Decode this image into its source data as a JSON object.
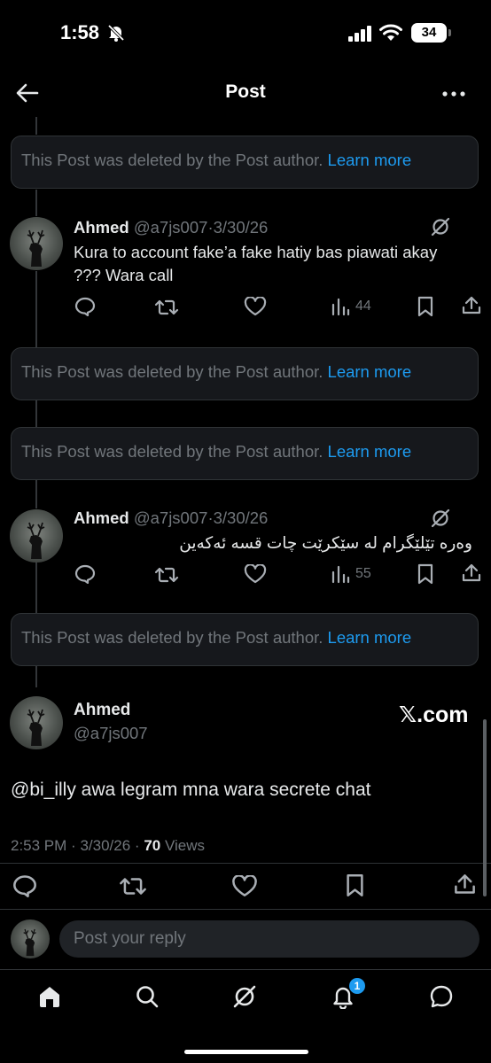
{
  "status_bar": {
    "time": "1:58",
    "battery": "34"
  },
  "header": {
    "title": "Post"
  },
  "deleted_notice": {
    "text": "This Post was deleted by the Post author.",
    "link": "Learn more"
  },
  "replies": [
    {
      "name": "Ahmed",
      "handle": "@a7js007",
      "separator": "·",
      "date": "3/30/26",
      "text": "Kura to account fake’a fake hatiy bas piawati akay ??? Wara call",
      "views": "44"
    },
    {
      "name": "Ahmed",
      "handle": "@a7js007",
      "separator": "·",
      "date": "3/30/26",
      "text": "وەرە تێلێگرام لە سێکرێت چات قسە ئەکەین",
      "views": "55"
    }
  ],
  "main_post": {
    "name": "Ahmed",
    "handle": "@a7js007",
    "source": "𝕏.com",
    "text": "@bi_illy awa legram mna wara secrete chat",
    "time": "2:53 PM",
    "date": "3/30/26",
    "separator": "·",
    "views_count": "70",
    "views_label": "Views"
  },
  "reply_box": {
    "placeholder": "Post your reply"
  },
  "bottom_nav": {
    "notification_count": "1"
  },
  "colors": {
    "background": "#000000",
    "accent": "#1d9bf0",
    "card": "#16181c",
    "muted": "#71767b",
    "text": "#e7e9ea"
  },
  "icons": [
    "bell-slash-icon",
    "signal-icon",
    "wifi-icon",
    "back-arrow-icon",
    "more-icon",
    "reply-icon",
    "repost-icon",
    "like-icon",
    "views-icon",
    "bookmark-icon",
    "share-icon",
    "grok-icon",
    "home-icon",
    "search-icon",
    "notifications-icon",
    "messages-icon"
  ]
}
